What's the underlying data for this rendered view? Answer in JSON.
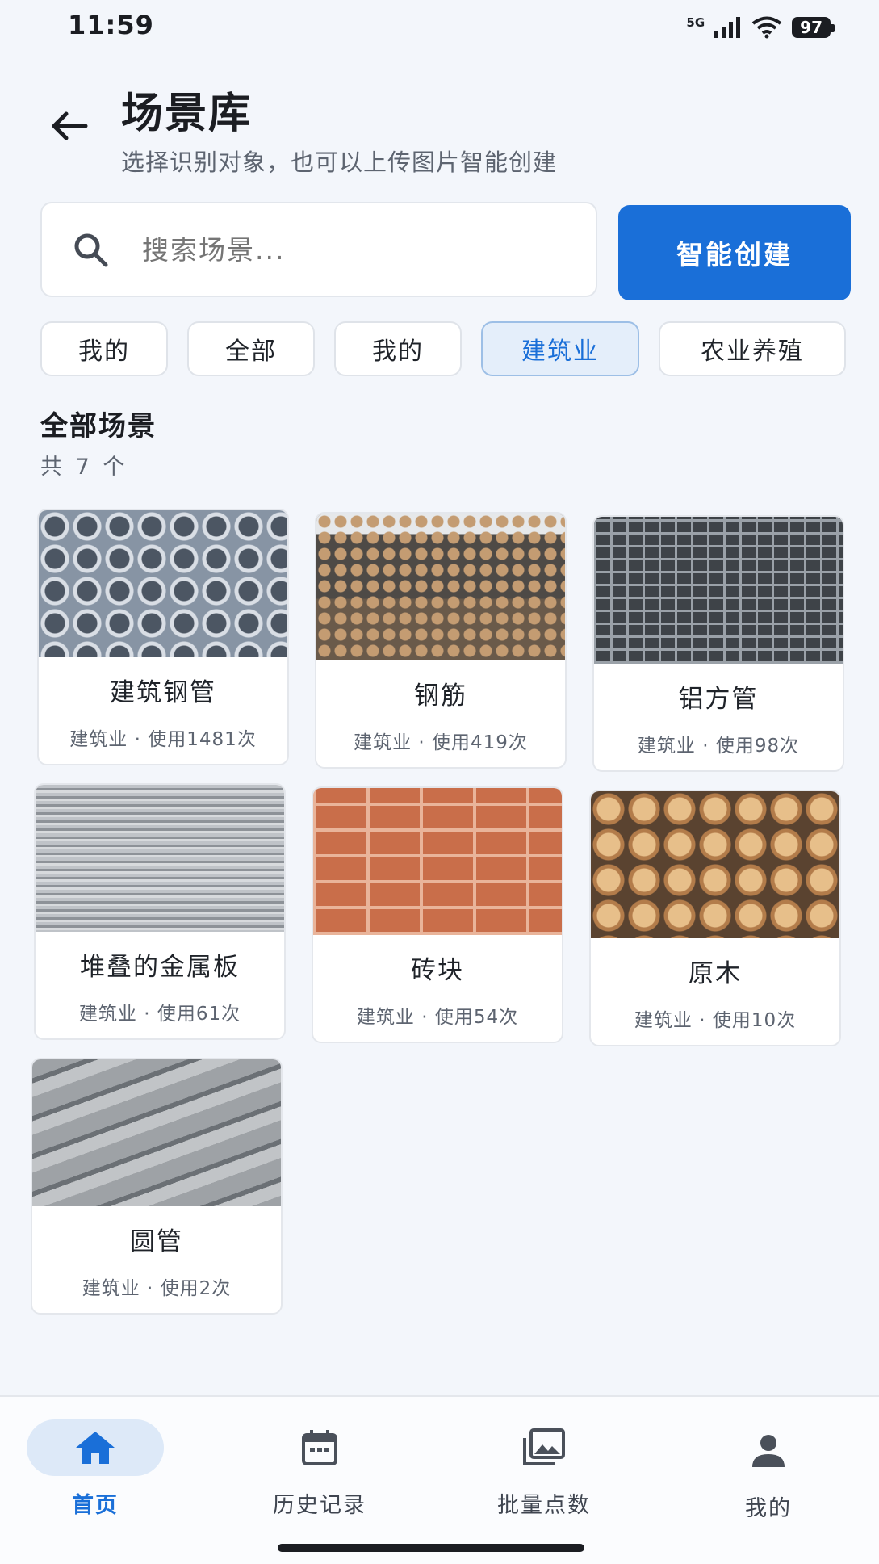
{
  "status": {
    "time": "11:59",
    "network": "5G",
    "battery": "97"
  },
  "header": {
    "title": "场景库",
    "subtitle": "选择识别对象，也可以上传图片智能创建"
  },
  "search": {
    "placeholder": "搜索场景..."
  },
  "create_button": {
    "label": "智能创建"
  },
  "chips": [
    {
      "label": "我的",
      "active": false
    },
    {
      "label": "全部",
      "active": false
    },
    {
      "label": "我的",
      "active": false
    },
    {
      "label": "建筑业",
      "active": true
    },
    {
      "label": "农业养殖",
      "active": false
    }
  ],
  "section": {
    "title": "全部场景",
    "count": "共 7 个"
  },
  "scenes": [
    {
      "name": "建筑钢管",
      "meta": "建筑业 · 使用1481次"
    },
    {
      "name": "钢筋",
      "meta": "建筑业 · 使用419次"
    },
    {
      "name": "铝方管",
      "meta": "建筑业 · 使用98次"
    },
    {
      "name": "堆叠的金属板",
      "meta": "建筑业 · 使用61次"
    },
    {
      "name": "砖块",
      "meta": "建筑业 · 使用54次"
    },
    {
      "name": "原木",
      "meta": "建筑业 · 使用10次"
    },
    {
      "name": "圆管",
      "meta": "建筑业 · 使用2次"
    }
  ],
  "tabs": [
    {
      "label": "首页",
      "icon": "home-icon",
      "active": true
    },
    {
      "label": "历史记录",
      "icon": "calendar-icon",
      "active": false
    },
    {
      "label": "批量点数",
      "icon": "image-icon",
      "active": false
    },
    {
      "label": "我的",
      "icon": "user-icon",
      "active": false
    }
  ],
  "colors": {
    "accent": "#1a6fd8",
    "background": "#f3f6fb",
    "chip_active_bg": "#e4eefa"
  }
}
